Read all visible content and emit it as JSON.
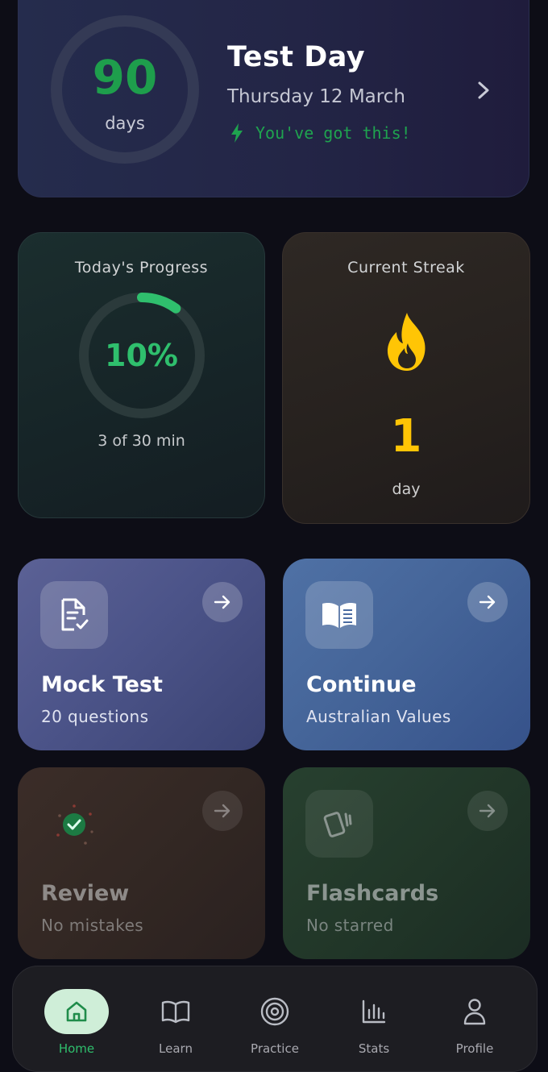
{
  "test_day": {
    "days_value": "90",
    "days_unit": "days",
    "title": "Test Day",
    "date": "Thursday 12 March",
    "motivation": "You've got this!"
  },
  "progress": {
    "label": "Today's Progress",
    "percent_text": "10%",
    "percent": 0.1,
    "subtitle": "3 of 30 min"
  },
  "streak": {
    "label": "Current Streak",
    "value": "1",
    "unit": "day"
  },
  "actions": [
    {
      "title": "Mock Test",
      "subtitle": "20 questions"
    },
    {
      "title": "Continue",
      "subtitle": "Australian Values"
    },
    {
      "title": "Review",
      "subtitle": "No mistakes"
    },
    {
      "title": "Flashcards",
      "subtitle": "No starred"
    }
  ],
  "nav": [
    {
      "label": "Home",
      "icon": "home-icon",
      "active": true
    },
    {
      "label": "Learn",
      "icon": "book-icon",
      "active": false
    },
    {
      "label": "Practice",
      "icon": "target-icon",
      "active": false
    },
    {
      "label": "Stats",
      "icon": "bar-chart-icon",
      "active": false
    },
    {
      "label": "Profile",
      "icon": "person-icon",
      "active": false
    }
  ],
  "colors": {
    "accent_green": "#2fbf6d",
    "streak_yellow": "#ffc505",
    "background": "#0d0d16"
  }
}
